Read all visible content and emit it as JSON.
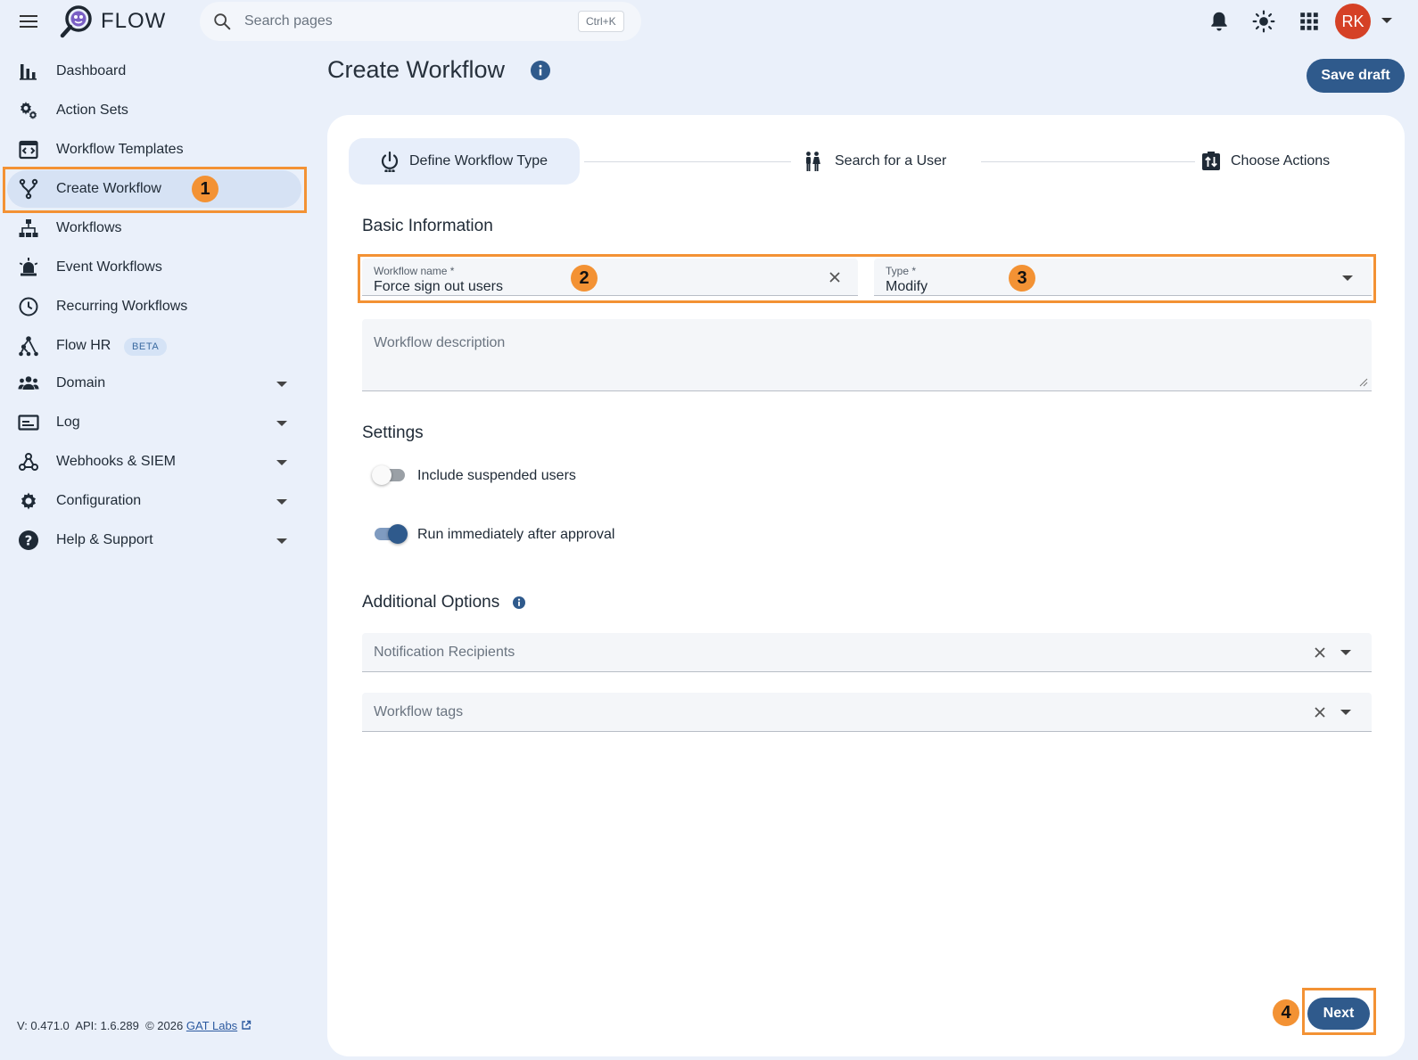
{
  "app": {
    "brand": "FLOW",
    "search_placeholder": "Search pages",
    "search_shortcut": "Ctrl+K",
    "user_initials": "RK"
  },
  "sidebar": {
    "items": [
      {
        "label": "Dashboard",
        "icon": "bar-chart-icon"
      },
      {
        "label": "Action Sets",
        "icon": "gears-icon"
      },
      {
        "label": "Workflow Templates",
        "icon": "template-icon"
      },
      {
        "label": "Create Workflow",
        "icon": "branch-icon",
        "active": true
      },
      {
        "label": "Workflows",
        "icon": "sitemap-icon"
      },
      {
        "label": "Event Workflows",
        "icon": "alarm-icon"
      },
      {
        "label": "Recurring Workflows",
        "icon": "clock-icon"
      },
      {
        "label": "Flow HR",
        "icon": "hierarchy-icon",
        "badge": "BETA"
      },
      {
        "label": "Domain",
        "icon": "users-icon",
        "expandable": true
      },
      {
        "label": "Log",
        "icon": "log-icon",
        "expandable": true
      },
      {
        "label": "Webhooks & SIEM",
        "icon": "webhook-icon",
        "expandable": true
      },
      {
        "label": "Configuration",
        "icon": "gear-icon",
        "expandable": true
      },
      {
        "label": "Help & Support",
        "icon": "help-icon",
        "expandable": true
      }
    ],
    "footer": {
      "version": "V: 0.471.0",
      "api": "API: 1.6.289",
      "copyright": "© 2026",
      "company": "GAT Labs"
    }
  },
  "main": {
    "title": "Create Workflow",
    "save_draft_label": "Save draft",
    "next_label": "Next",
    "steps": [
      {
        "label": "Define Workflow Type",
        "icon": "power-icon",
        "active": true
      },
      {
        "label": "Search for a User",
        "icon": "people-icon"
      },
      {
        "label": "Choose Actions",
        "icon": "swap-icon"
      }
    ],
    "basic_info": {
      "title": "Basic Information",
      "workflow_name_label": "Workflow name *",
      "workflow_name_value": "Force sign out users",
      "type_label": "Type *",
      "type_value": "Modify",
      "description_placeholder": "Workflow description"
    },
    "settings": {
      "title": "Settings",
      "toggles": [
        {
          "label": "Include suspended users",
          "on": false
        },
        {
          "label": "Run immediately after approval",
          "on": true
        }
      ]
    },
    "additional": {
      "title": "Additional Options",
      "notification_placeholder": "Notification Recipients",
      "tags_placeholder": "Workflow tags"
    }
  },
  "annotations": [
    "1",
    "2",
    "3",
    "4"
  ],
  "colors": {
    "accent": "#2f5a8c",
    "highlight": "#f39234",
    "avatar": "#d54126",
    "background": "#eaf0fa"
  }
}
